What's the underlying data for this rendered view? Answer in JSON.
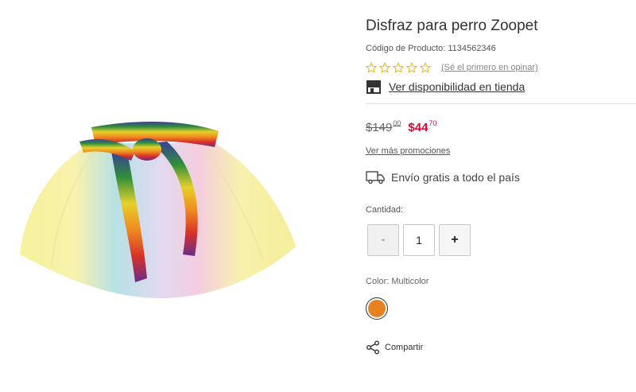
{
  "product": {
    "title": "Disfraz para perro Zoopet",
    "code_text": "Código de Producto: 1134562346",
    "rating_link": "(Sé el primero en opinar)",
    "store_link": "Ver disponibilidad en tienda"
  },
  "price": {
    "old_whole": "$149",
    "old_cents": "00",
    "new_whole": "$44",
    "new_cents": "70"
  },
  "promos_link": "Ver más promociones",
  "shipping_text": "Envío gratis a todo el país",
  "quantity": {
    "label": "Cantidad:",
    "minus": "-",
    "value": "1",
    "plus": "+"
  },
  "color": {
    "label": "Color: Multicolor",
    "swatch_hex": "#e8821e"
  },
  "share_label": "Compartir",
  "colors": {
    "star_outline": "#e8b400",
    "sale_red": "#e4032e"
  }
}
